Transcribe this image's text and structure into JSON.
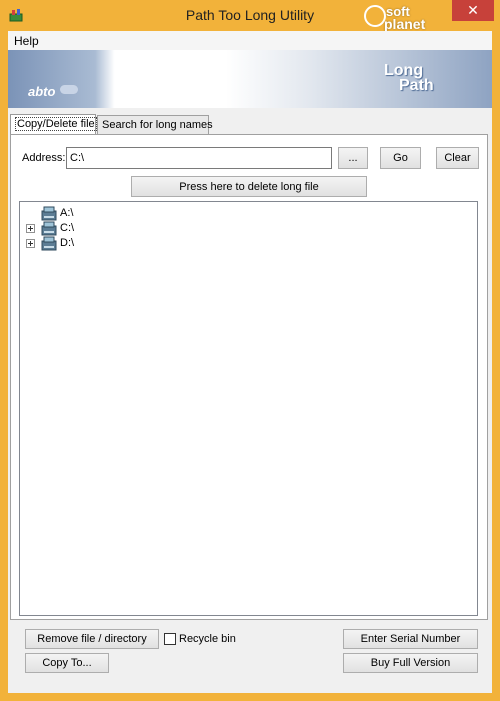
{
  "window": {
    "title": "Path Too Long Utility",
    "watermark_line1": "soft",
    "watermark_line2": "planet",
    "close_glyph": "✕"
  },
  "menu": {
    "items": [
      {
        "label": "Help"
      }
    ]
  },
  "banner": {
    "logo_text": "abto",
    "product_line1": "Long",
    "product_line2": "Path"
  },
  "tabs": [
    {
      "label": "Copy/Delete file",
      "active": true
    },
    {
      "label": "Search for long names",
      "active": false
    }
  ],
  "address": {
    "label": "Address:",
    "value": "C:\\",
    "browse_label": "...",
    "go_label": "Go",
    "clear_label": "Clear"
  },
  "delete_long_file_label": "Press here to delete long file",
  "tree": {
    "items": [
      {
        "label": "A:\\",
        "expandable": false,
        "icon": "drive-icon"
      },
      {
        "label": "C:\\",
        "expandable": true,
        "icon": "drive-icon"
      },
      {
        "label": "D:\\",
        "expandable": true,
        "icon": "drive-icon"
      }
    ]
  },
  "footer": {
    "remove_label": "Remove file / directory",
    "recycle_label": "Recycle bin",
    "recycle_checked": false,
    "copy_label": "Copy To...",
    "serial_label": "Enter Serial Number",
    "buy_label": "Buy Full Version"
  },
  "colors": {
    "titlebar": "#f2b23a",
    "close_button": "#c7413a",
    "window_bg": "#f0f0f0"
  }
}
